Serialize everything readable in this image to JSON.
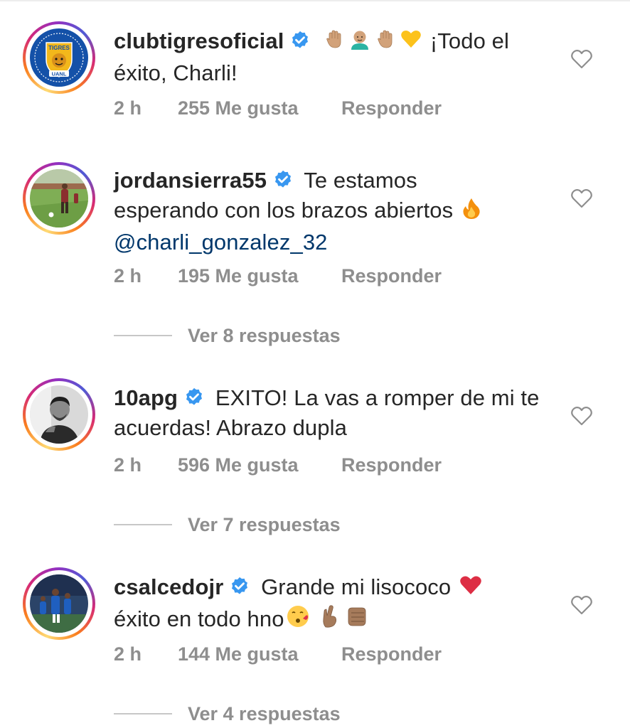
{
  "comments": [
    {
      "username": "clubtigresoficial",
      "verified": true,
      "text_after_emojis": "¡Todo el éxito, Charli!",
      "emojis": [
        "raised-hand-medium-light",
        "man-bald-medium-light",
        "raised-hand-medium-light",
        "yellow-heart"
      ],
      "time": "2 h",
      "likes": "255 Me gusta",
      "reply": "Responder",
      "avatar_icon": "tigres-uanl-logo",
      "avatar_text_top": "TIGRES",
      "avatar_text_bottom": "UANL"
    },
    {
      "username": "jordansierra55",
      "verified": true,
      "text_line1": "Te estamos",
      "text_line2": "esperando con los brazos abiertos",
      "emoji": "fire",
      "mention": "@charli_gonzalez_32",
      "time": "2 h",
      "likes": "195 Me gusta",
      "reply": "Responder",
      "avatar_icon": "soccer-player-training-photo",
      "replies_label": "Ver 8 respuestas"
    },
    {
      "username": "10apg",
      "verified": true,
      "text": "EXITO! La vas a romper de mi te acuerdas! Abrazo dupla",
      "time": "2 h",
      "likes": "596 Me gusta",
      "reply": "Responder",
      "avatar_icon": "man-portrait-bw-photo",
      "replies_label": "Ver 7 respuestas"
    },
    {
      "username": "csalcedojr",
      "verified": true,
      "text_line1": "Grande mi lisococo",
      "text_line2": "éxito en todo hno",
      "emojis": [
        "red-heart",
        "face-blowing-kiss",
        "crossed-fingers-medium",
        "oncoming-fist-medium"
      ],
      "time": "2 h",
      "likes": "144 Me gusta",
      "reply": "Responder",
      "avatar_icon": "soccer-players-stadium-photo",
      "replies_label": "Ver 4 respuestas"
    }
  ],
  "colors": {
    "text": "#262626",
    "muted": "#8e8e8e",
    "verified_blue": "#3897f0",
    "mention": "#00376b"
  }
}
